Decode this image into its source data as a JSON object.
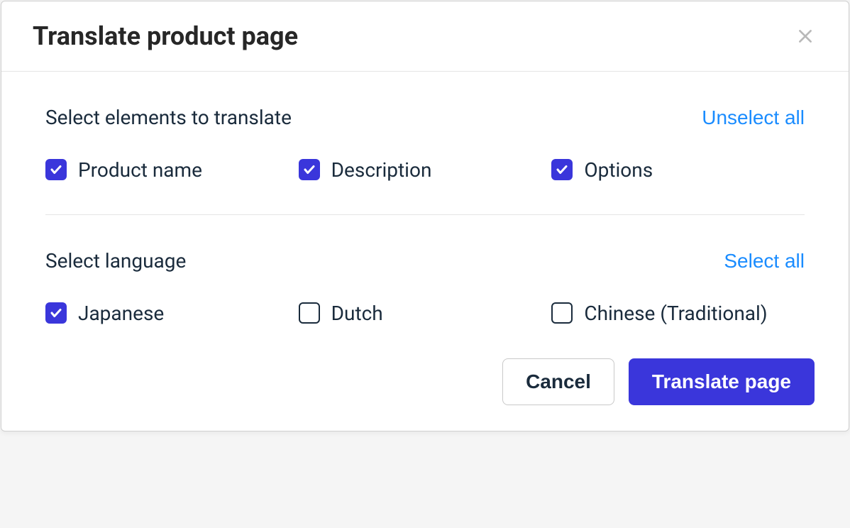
{
  "modal": {
    "title": "Translate product page",
    "elements_section": {
      "title": "Select elements to translate",
      "toggle_label": "Unselect all",
      "items": [
        {
          "label": "Product name",
          "checked": true
        },
        {
          "label": "Description",
          "checked": true
        },
        {
          "label": "Options",
          "checked": true
        }
      ]
    },
    "language_section": {
      "title": "Select language",
      "toggle_label": "Select all",
      "items": [
        {
          "label": "Japanese",
          "checked": true
        },
        {
          "label": "Dutch",
          "checked": false
        },
        {
          "label": "Chinese (Traditional)",
          "checked": false
        }
      ]
    },
    "footer": {
      "cancel_label": "Cancel",
      "submit_label": "Translate page"
    }
  }
}
